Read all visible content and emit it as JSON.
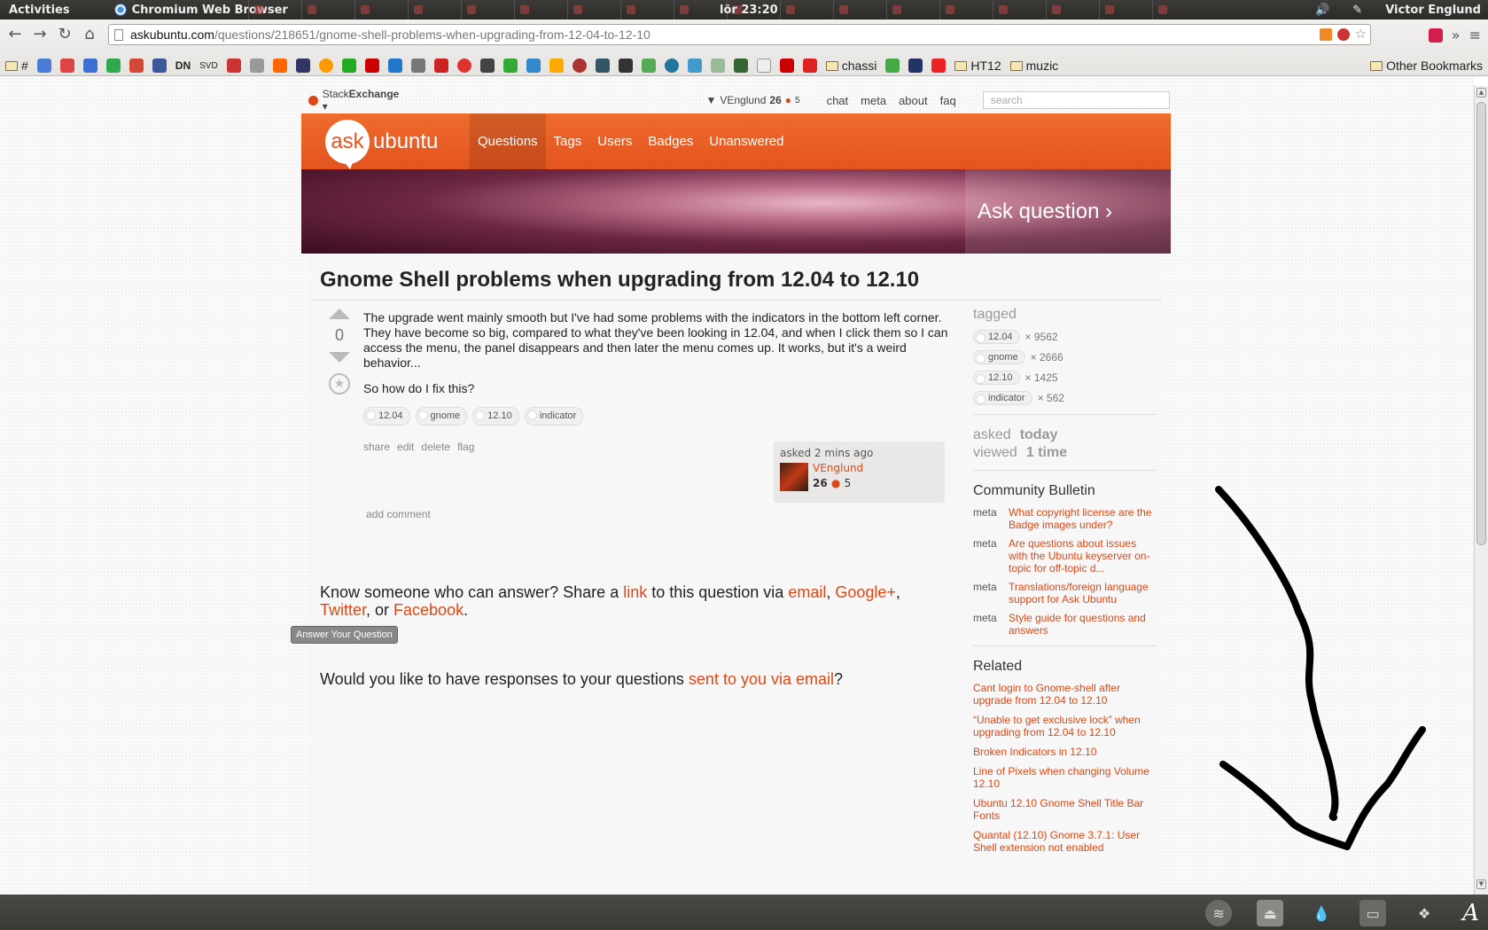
{
  "system": {
    "activities": "Activities",
    "app_name": "Chromium Web Browser",
    "clock": "lör 23:20",
    "user": "Victor Englund"
  },
  "browser": {
    "url_host": "askubuntu.com",
    "url_path": "/questions/218651/gnome-shell-problems-when-upgrading-from-12-04-to-12-10",
    "bookmarks": [
      "#",
      "SVD",
      "DN",
      "chassi",
      "HT12",
      "muzic"
    ],
    "other_bookmarks": "Other Bookmarks"
  },
  "se": {
    "brand_a": "Stack",
    "brand_b": "Exchange",
    "user": "VEnglund",
    "rep": "26",
    "badges": "5",
    "links": [
      "chat",
      "meta",
      "about",
      "faq"
    ],
    "search_placeholder": "search"
  },
  "site": {
    "logo_ask": "ask",
    "logo_ubuntu": "ubuntu",
    "nav": [
      "Questions",
      "Tags",
      "Users",
      "Badges",
      "Unanswered"
    ],
    "ask_question": "Ask question ›"
  },
  "question": {
    "title": "Gnome Shell problems when upgrading from 12.04 to 12.10",
    "votes": "0",
    "body_p1": "The upgrade went mainly smooth but I've had some problems with the indicators in the bottom left corner. They have become so big, compared to what they've been looking in 12.04, and when I click them so I can access the menu, the panel disappears and then later the menu comes up. It works, but it's a weird behavior...",
    "body_p2": "So how do I fix this?",
    "tags": [
      "12.04",
      "gnome",
      "12.10",
      "indicator"
    ],
    "menu": [
      "share",
      "edit",
      "delete",
      "flag"
    ],
    "asked": "asked 2 mins ago",
    "owner": "VEnglund",
    "owner_rep": "26",
    "owner_badges": "5",
    "add_comment": "add comment"
  },
  "share": {
    "t1": "Know someone who can answer? Share a ",
    "link": "link",
    "t2": " to this question via ",
    "email": "email",
    "google": "Google+",
    "twitter": "Twitter",
    "t3": ", or ",
    "facebook": "Facebook",
    "button": "Answer Your Question",
    "email_q1": "Would you like to have responses to your questions ",
    "email_q_link": "sent to you via email",
    "email_q2": "?"
  },
  "sidebar": {
    "tagged": "tagged",
    "tag_counts": [
      {
        "tag": "12.04",
        "count": "× 9562"
      },
      {
        "tag": "gnome",
        "count": "× 2666"
      },
      {
        "tag": "12.10",
        "count": "× 1425"
      },
      {
        "tag": "indicator",
        "count": "× 562"
      }
    ],
    "asked_label": "asked",
    "asked_value": "today",
    "viewed_label": "viewed",
    "viewed_value": "1 time",
    "bulletin_title": "Community Bulletin",
    "bulletin": [
      {
        "label": "meta",
        "text": "What copyright license are the Badge images under?"
      },
      {
        "label": "meta",
        "text": "Are questions about issues with the Ubuntu keyserver on-topic for off-topic d..."
      },
      {
        "label": "meta",
        "text": "Translations/foreign language support for Ask Ubuntu"
      },
      {
        "label": "meta",
        "text": "Style guide for questions and answers"
      }
    ],
    "related_title": "Related",
    "related": [
      "Cant login to Gnome-shell after upgrade from 12.04 to 12.10",
      "“Unable to get exclusive lock” when upgrading from 12.04 to 12.10",
      "Broken Indicators in 12.10",
      "Line of Pixels when changing Volume 12.10",
      "Ubuntu 12.10 Gnome Shell Title Bar Fonts",
      "Quantal (12.10) Gnome 3.7.1: User Shell extension not enabled"
    ]
  },
  "tray": {
    "letter": "A"
  },
  "colors": {
    "accent": "#dd4814",
    "header": "#e3541f"
  }
}
